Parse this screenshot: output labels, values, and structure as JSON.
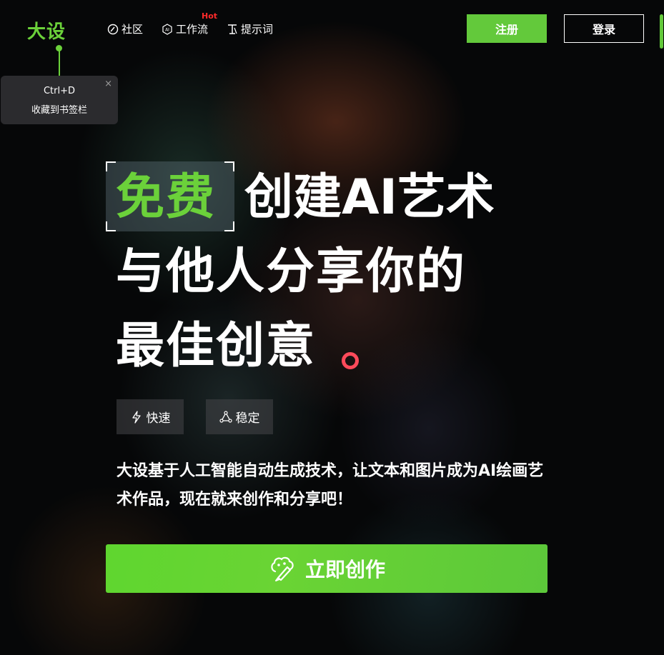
{
  "header": {
    "logo": "大设",
    "nav": [
      {
        "label": "社区",
        "icon": "community-icon"
      },
      {
        "label": "工作流",
        "icon": "ai-workflow-icon",
        "badge": "Hot"
      },
      {
        "label": "提示词",
        "icon": "prompt-icon"
      }
    ],
    "register_label": "注册",
    "login_label": "登录"
  },
  "tooltip": {
    "shortcut": "Ctrl+D",
    "text": "收藏到书签栏",
    "close": "×"
  },
  "hero": {
    "highlight": "免费",
    "line1_rest": "创建AI艺术",
    "line2": "与他人分享你的",
    "line3": "最佳创意"
  },
  "tags": [
    {
      "label": "快速",
      "icon": "lightning-icon"
    },
    {
      "label": "稳定",
      "icon": "triangle-nodes-icon"
    }
  ],
  "description": "大设基于人工智能自动生成技术，让文本和图片成为AI绘画艺术作品，现在就来创作和分享吧！",
  "cta": {
    "label": "立即创作",
    "icon": "brain-brush-icon"
  },
  "colors": {
    "brand_green": "#63c93b",
    "hot_red": "#ff2a2a",
    "dot_red": "#ff4a5a"
  }
}
